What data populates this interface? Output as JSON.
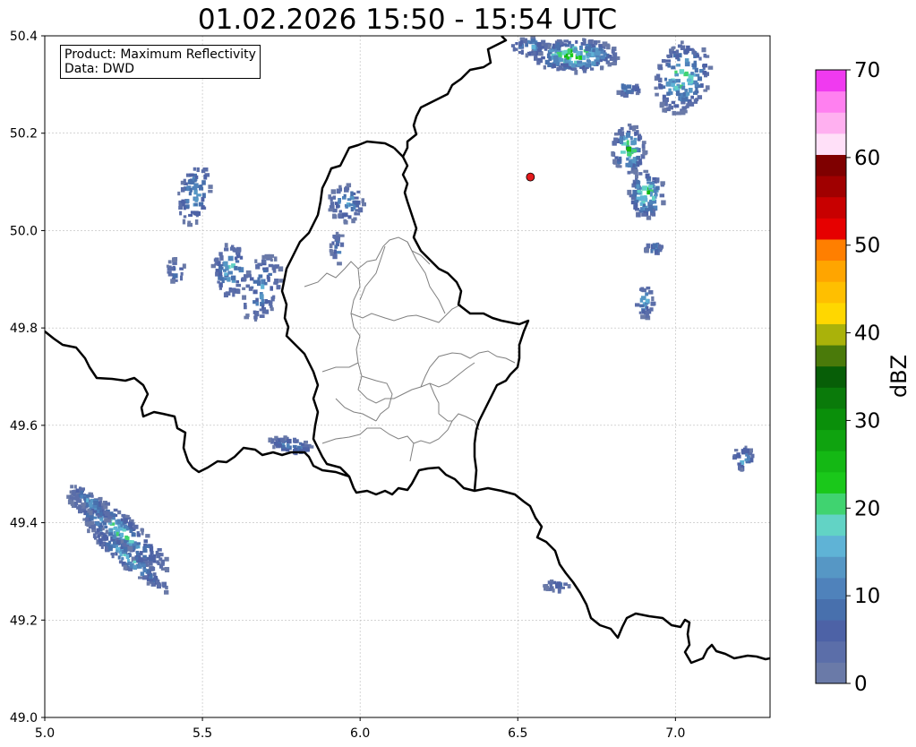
{
  "title": "01.02.2026 15:50 - 15:54 UTC",
  "info": {
    "product_line": "Product: Maximum Reflectivity",
    "data_line": "Data: DWD"
  },
  "map": {
    "lon_range": [
      5.0,
      7.3
    ],
    "lat_range": [
      49.0,
      50.4
    ],
    "lon_ticks": [
      "5.0",
      "5.5",
      "6.0",
      "6.5",
      "7.0"
    ],
    "lat_ticks": [
      "49.0",
      "49.2",
      "49.4",
      "49.6",
      "49.8",
      "50.0",
      "50.2",
      "50.4"
    ],
    "grid": true,
    "marker": {
      "lon": 6.54,
      "lat": 50.11,
      "color": "#e31a1c"
    }
  },
  "colorbar": {
    "label": "dBZ",
    "min": 0,
    "max": 70,
    "ticks": [
      "0",
      "10",
      "20",
      "30",
      "40",
      "50",
      "60",
      "70"
    ],
    "colors": [
      "#6a7aa8",
      "#5b6ea9",
      "#4d62a6",
      "#4870ad",
      "#4f82bb",
      "#5697c5",
      "#5fb3d6",
      "#62d3c5",
      "#40d370",
      "#1ac81a",
      "#14b814",
      "#0fa30f",
      "#0a8f0a",
      "#0a7a0a",
      "#075e07",
      "#4a7a0a",
      "#aab20a",
      "#ffd700",
      "#ffbf00",
      "#ffa500",
      "#ff7f00",
      "#e60000",
      "#c80000",
      "#a00000",
      "#7f0000",
      "#ffe0f8",
      "#ffb0f0",
      "#ff80f0",
      "#f03af0"
    ]
  },
  "colors": {
    "border_national": "#000000",
    "border_regional": "#808080",
    "grid": "#bbbbbb"
  }
}
